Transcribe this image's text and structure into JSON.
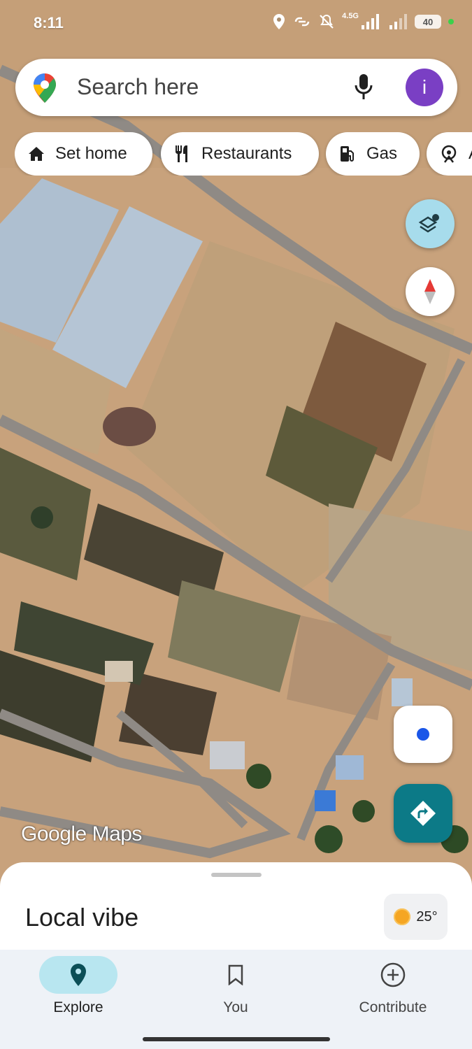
{
  "status_bar": {
    "time": "8:11",
    "network_label": "4.5G",
    "battery": "40",
    "icons": [
      "location-icon",
      "link-icon",
      "mute-icon",
      "signal-icon",
      "signal-icon-2",
      "battery-icon",
      "green-dot"
    ]
  },
  "search": {
    "placeholder": "Search here",
    "avatar_letter": "i",
    "logo": "maps-pin-logo",
    "mic_icon": "mic-icon"
  },
  "chips": [
    {
      "label": "Set home",
      "icon": "home-icon"
    },
    {
      "label": "Restaurants",
      "icon": "fork-knife-icon"
    },
    {
      "label": "Gas",
      "icon": "gas-pump-icon"
    },
    {
      "label": "A",
      "icon": "attraction-icon"
    }
  ],
  "map": {
    "watermark": "Google Maps",
    "type": "satellite"
  },
  "controls": {
    "layers_icon": "layers-icon",
    "compass_icon": "compass-icon",
    "locate_icon": "my-location-icon",
    "directions_icon": "directions-icon"
  },
  "sheet": {
    "title": "Local vibe",
    "temperature": "25°",
    "weather_icon": "sun-icon"
  },
  "bottom_nav": [
    {
      "label": "Explore",
      "icon": "explore-pin-icon",
      "active": true
    },
    {
      "label": "You",
      "icon": "bookmark-icon",
      "active": false
    },
    {
      "label": "Contribute",
      "icon": "add-circle-icon",
      "active": false
    }
  ],
  "colors": {
    "accent": "#0c7a87",
    "avatar": "#7a3fc4",
    "active_pill": "#b8e6f0",
    "locate_dot": "#1a56e8"
  }
}
